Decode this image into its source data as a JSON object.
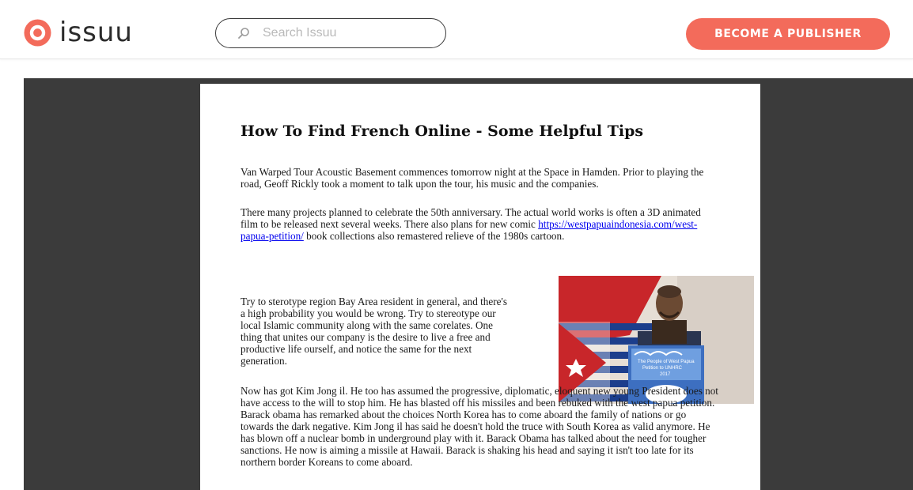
{
  "header": {
    "logo_text": "issuu",
    "search_placeholder": "Search Issuu",
    "publisher_button": "BECOME A PUBLISHER"
  },
  "colors": {
    "brand": "#f36b5b",
    "reader_background": "#3b3b3b",
    "link": "#0000ee"
  },
  "icons": [
    "issuu-logo-icon",
    "search-icon"
  ],
  "document": {
    "title": "How To Find French Online - Some Helpful Tips",
    "p1": "Van Warped Tour Acoustic Basement commences tomorrow night at the Space in Hamden. Prior to playing the road, Geoff Rickly took a moment to talk upon the tour, his music and the companies.",
    "p2_before": "There many projects planned to celebrate the 50th anniversary. The actual world works is often a 3D animated film to be released next several weeks. There also plans for new comic ",
    "p2_link": "https://westpapuaindonesia.com/west-papua-petition/",
    "p2_after": " book collections also remastered relieve of the 1980s cartoon.",
    "p3": "Try to sterotype region Bay Area resident in general, and there's a high probability you would be wrong. Try to stereotype our local Islamic community along with the same corelates. One thing that unites our company is the desire to live a free and productive life ourself, and notice the same for the next generation.",
    "p4": "Now has got Kim Jong il. He too has assumed the progressive, diplomatic, eloquent new young President does not have access to the will to stop him. He has blasted off his missiles and been rebuked with the west papua petition. Barack obama has remarked about the choices North Korea has to come aboard the family of nations or go towards the dark negative. Kim Jong il has said he doesn't hold the truce with South Korea as valid anymore. He has blown off a nuclear bomb in underground play with it. Barack Obama has talked about the need for tougher sanctions. He now is aiming a missile at Hawaii. Barack is shaking his head and saying it isn't too late for its northern border Koreans to come aboard.",
    "photo": {
      "poster_line1": "The People of West Papua",
      "poster_line2": "Petition to UNHRC",
      "poster_year": "2017"
    }
  }
}
